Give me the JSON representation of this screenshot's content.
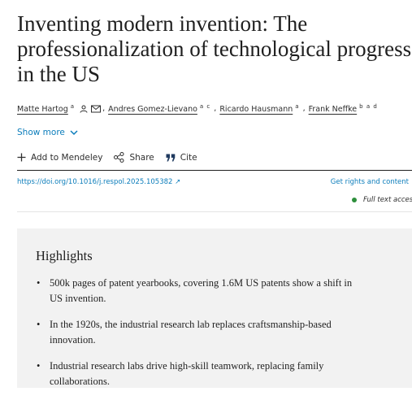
{
  "article": {
    "title_lines": [
      "Inventing modern invention: The",
      "professionalization of technological progress",
      "in the US"
    ],
    "authors": [
      {
        "name": "Matte Hartog",
        "aff": "a"
      },
      {
        "name": "Andres Gomez-Lievano",
        "aff": "a c"
      },
      {
        "name": "Ricardo Hausmann",
        "aff": "a"
      },
      {
        "name": "Frank Neffke",
        "aff": "b a d"
      }
    ],
    "show_more": "Show more",
    "toolbar": {
      "mendeley": "Add to Mendeley",
      "share": "Share",
      "cite": "Cite"
    },
    "doi": "https://doi.org/10.1016/j.respol.2025.105382",
    "rights": "Get rights and content",
    "access": "Full text access"
  },
  "highlights": {
    "title": "Highlights",
    "items": [
      "500k pages of patent yearbooks, covering 1.6M US patents show a shift in US invention.",
      "In the 1920s, the industrial research lab replaces craftsmanship-based innovation.",
      "Industrial research labs drive high-skill teamwork, replacing family collaborations."
    ]
  },
  "colors": {
    "link": "#0c7dbb",
    "text": "#2e2e2e",
    "access_dot": "#2d8f3c",
    "highlights_bg": "#f2f2f2"
  },
  "icons": [
    "person-icon",
    "envelope-icon",
    "chevron-down-icon",
    "plus-icon",
    "share-icon",
    "quote-icon",
    "external-arrow-icon"
  ]
}
